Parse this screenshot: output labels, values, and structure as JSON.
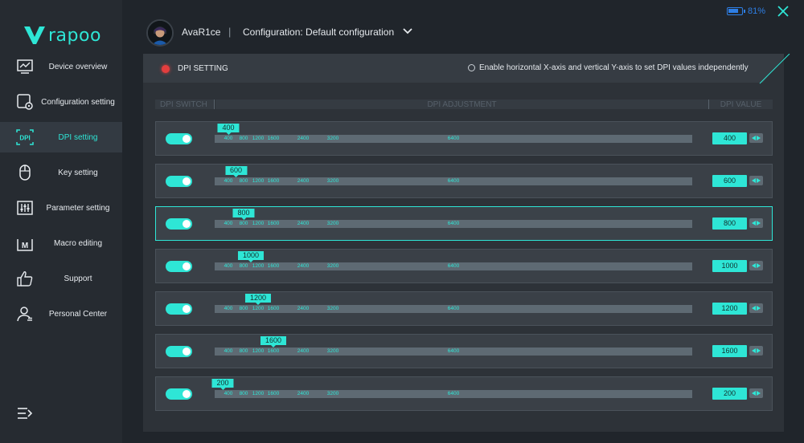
{
  "brand": {
    "logo_text": "rapoo"
  },
  "sidebar": {
    "items": [
      {
        "id": "device-overview",
        "label": "Device overview",
        "icon": "chart-monitor-icon"
      },
      {
        "id": "configuration-setting",
        "label": "Configuration setting",
        "icon": "config-gear-icon"
      },
      {
        "id": "dpi-setting",
        "label": "DPI setting",
        "icon": "dpi-icon",
        "icon_text": "DPI",
        "active": true
      },
      {
        "id": "key-setting",
        "label": "Key setting",
        "icon": "mouse-icon"
      },
      {
        "id": "parameter-setting",
        "label": "Parameter setting",
        "icon": "sliders-icon"
      },
      {
        "id": "macro-editing",
        "label": "Macro editing",
        "icon": "macro-icon",
        "icon_text": "M"
      },
      {
        "id": "support",
        "label": "Support",
        "icon": "thumbs-up-icon"
      },
      {
        "id": "personal-center",
        "label": "Personal Center",
        "icon": "user-icon"
      }
    ]
  },
  "header": {
    "username": "AvaR1ce",
    "separator": "|",
    "configuration": "Configuration: Default configuration",
    "battery_percent": "81%",
    "battery_level": 0.81
  },
  "panel": {
    "title": "DPI SETTING",
    "xy_option_label": "Enable horizontal X-axis and vertical Y-axis to set DPI values independently",
    "columns": {
      "switch": "DPI SWITCH",
      "adjust": "DPI ADJUSTMENT",
      "value": "DPI VALUE"
    },
    "ticks": [
      "400",
      "800",
      "1200",
      "1600",
      "2400",
      "3200",
      "6400"
    ],
    "rows": [
      {
        "value": "400",
        "enabled": true,
        "selected": false
      },
      {
        "value": "600",
        "enabled": true,
        "selected": false
      },
      {
        "value": "800",
        "enabled": true,
        "selected": true
      },
      {
        "value": "1000",
        "enabled": true,
        "selected": false
      },
      {
        "value": "1200",
        "enabled": true,
        "selected": false
      },
      {
        "value": "1600",
        "enabled": true,
        "selected": false
      },
      {
        "value": "200",
        "enabled": true,
        "selected": false
      }
    ]
  },
  "colors": {
    "accent": "#2ee6d6",
    "indicator_red": "#e33e3e",
    "battery_blue": "#2e7fe6"
  }
}
